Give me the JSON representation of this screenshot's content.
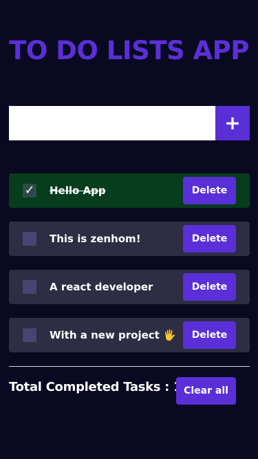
{
  "app": {
    "title": "TO DO LISTS APP"
  },
  "input": {
    "value": "",
    "placeholder": "",
    "add_label": "+"
  },
  "tasks": [
    {
      "text": "Hello App",
      "completed": true,
      "delete_label": "Delete"
    },
    {
      "text": "This is zenhom!",
      "completed": false,
      "delete_label": "Delete"
    },
    {
      "text": "A react developer",
      "completed": false,
      "delete_label": "Delete"
    },
    {
      "text": "With a new project 🖐",
      "completed": false,
      "delete_label": "Delete"
    }
  ],
  "footer": {
    "total_label": "Total Completed Tasks : 1",
    "clear_label": "Clear all"
  },
  "colors": {
    "background": "#090a21",
    "accent": "#5a2fd8",
    "task_bg": "#2d2d43",
    "completed_bg": "#073d1d"
  },
  "icons": {
    "checkmark": "check-icon",
    "add": "plus-icon"
  }
}
